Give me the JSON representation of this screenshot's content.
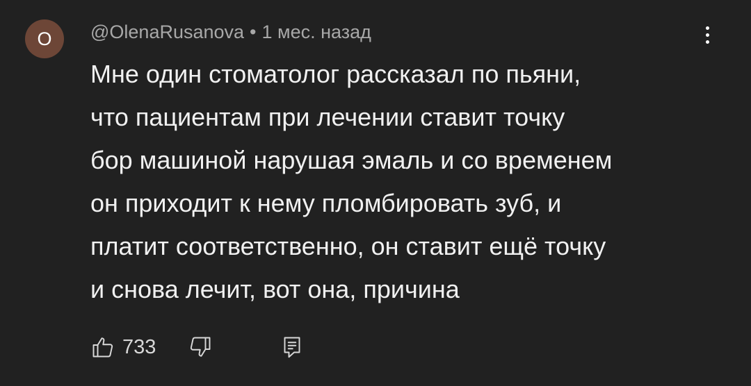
{
  "comment": {
    "avatar_letter": "O",
    "author": "@OlenaRusanova",
    "separator": "•",
    "time": "1 мес. назад",
    "text_lines": [
      "Мне один стоматолог рассказал по пьяни,",
      "что пациентам при лечении ставит точку",
      "бор машиной нарушая эмаль и со временем",
      "он приходит к нему пломбировать зуб, и",
      "платит соответственно, он ставит ещё точку",
      "и снова лечит, вот она, причина"
    ],
    "like_count": "733"
  },
  "icons": {
    "more": "vertical-ellipsis-icon",
    "like": "thumbs-up-icon",
    "dislike": "thumbs-down-icon",
    "reply": "reply-comment-icon"
  },
  "colors": {
    "background": "#212121",
    "avatar": "#6d4637",
    "meta_text": "#a8a8a8",
    "body_text": "#f1f1f1"
  }
}
